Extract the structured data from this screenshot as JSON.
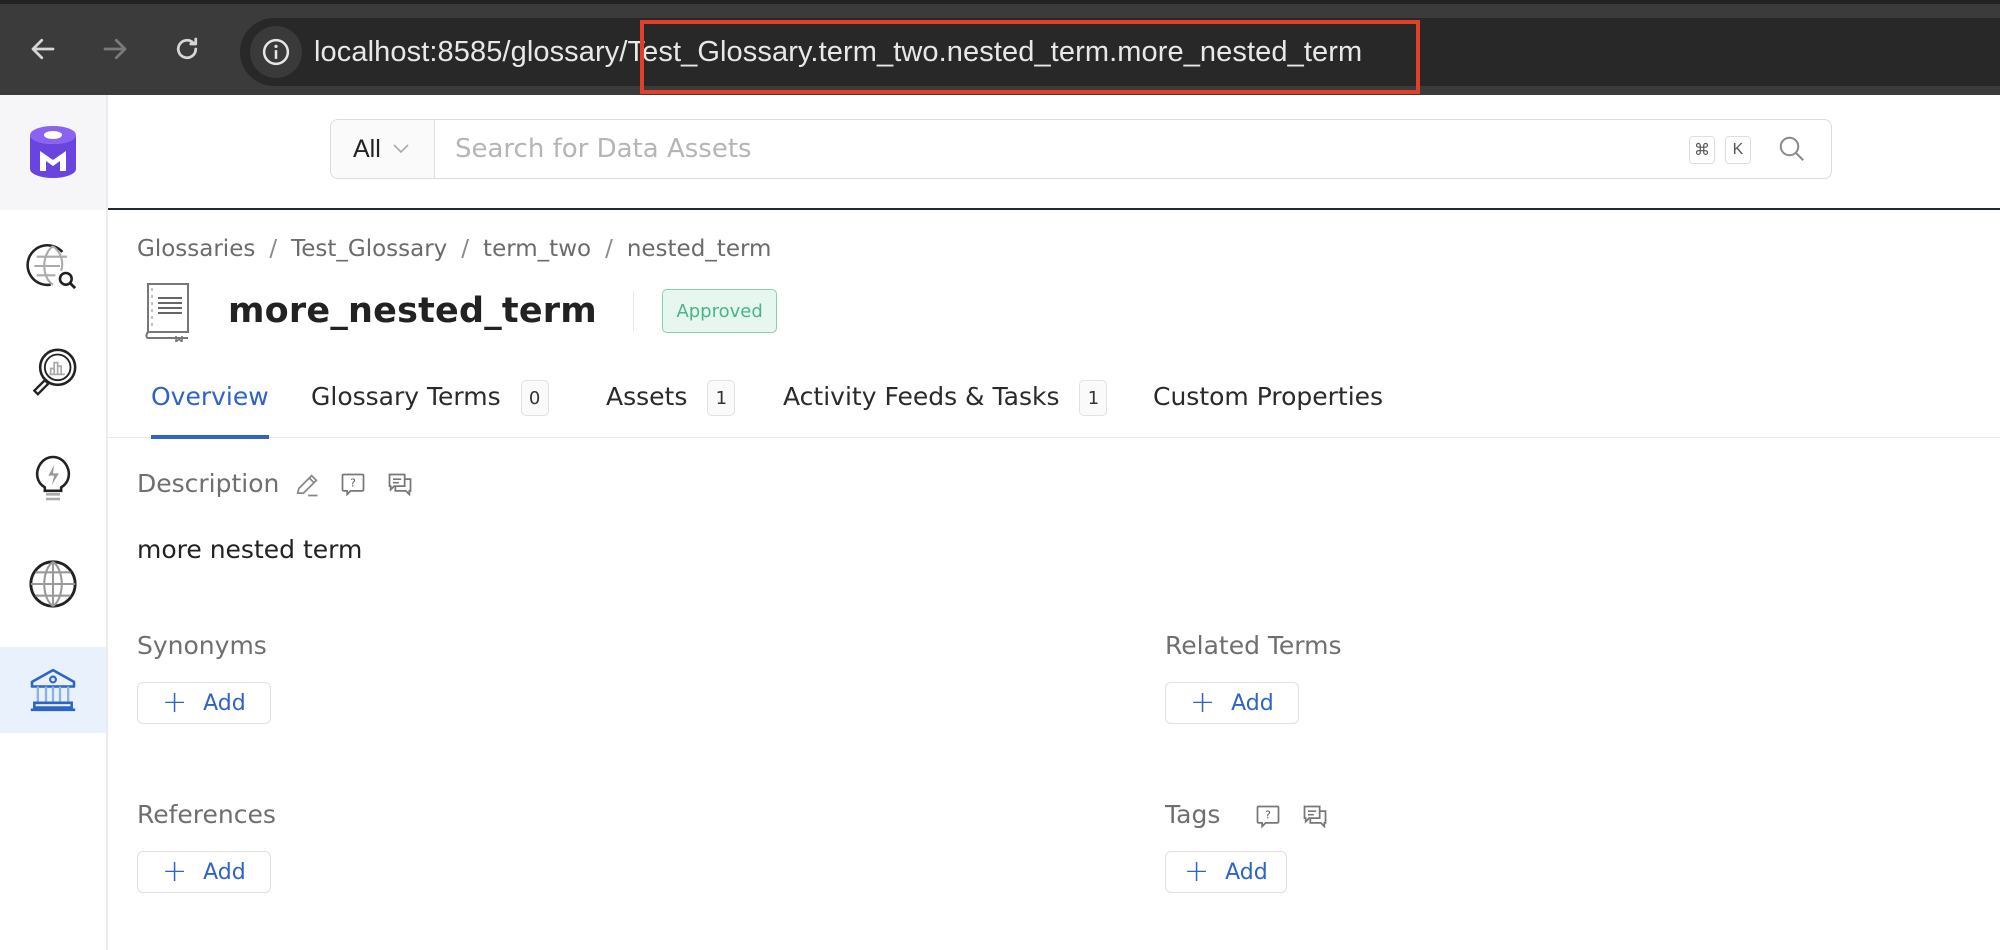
{
  "browser": {
    "url_host": "localhost:8585/glossary/",
    "url_path": "Test_Glossary.term_two.nested_term.more_nested_term",
    "highlight_color": "#e0402a"
  },
  "sidebar": {
    "logo": "openmetadata-logo",
    "items": [
      {
        "name": "explore",
        "icon": "globe-search-icon",
        "active": false
      },
      {
        "name": "data-quality",
        "icon": "magnifier-chart-icon",
        "active": false
      },
      {
        "name": "insights",
        "icon": "lightbulb-icon",
        "active": false
      },
      {
        "name": "domains",
        "icon": "globe-icon",
        "active": false
      },
      {
        "name": "governance",
        "icon": "bank-icon",
        "active": true
      }
    ]
  },
  "search": {
    "filter_value": "All",
    "placeholder": "Search for Data Assets",
    "shortcut_keys": [
      "⌘",
      "K"
    ]
  },
  "breadcrumb": [
    "Glossaries",
    "Test_Glossary",
    "term_two",
    "nested_term"
  ],
  "breadcrumb_separator": "/",
  "term": {
    "title": "more_nested_term",
    "status": "Approved",
    "description": "more nested term"
  },
  "tabs": [
    {
      "label": "Overview",
      "count": null,
      "active": true
    },
    {
      "label": "Glossary Terms",
      "count": "0",
      "active": false
    },
    {
      "label": "Assets",
      "count": "1",
      "active": false
    },
    {
      "label": "Activity Feeds & Tasks",
      "count": "1",
      "active": false
    },
    {
      "label": "Custom Properties",
      "count": null,
      "active": false
    }
  ],
  "sections": {
    "description_label": "Description",
    "synonyms_label": "Synonyms",
    "related_terms_label": "Related Terms",
    "references_label": "References",
    "tags_label": "Tags",
    "add_label": "Add"
  },
  "colors": {
    "accent": "#2e63c7",
    "status_approved": "#4bb38a",
    "logo": "#7147e8"
  }
}
